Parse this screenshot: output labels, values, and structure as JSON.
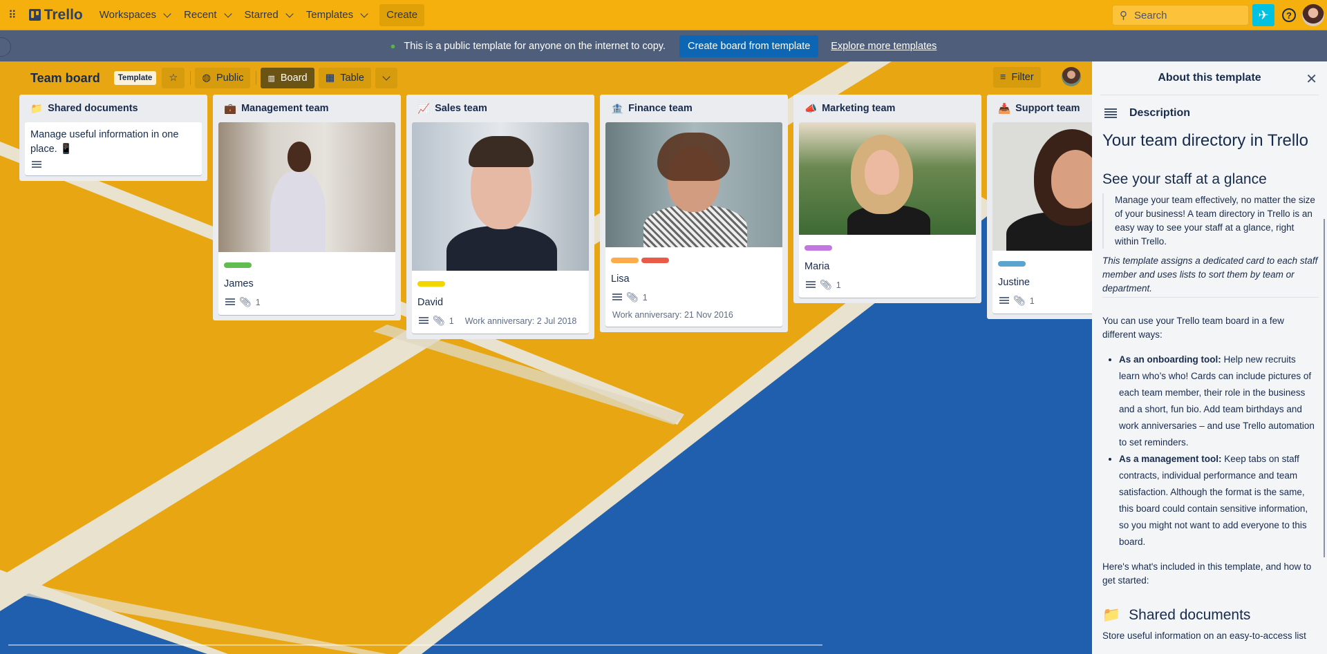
{
  "topbar": {
    "logo": "Trello",
    "nav": [
      "Workspaces",
      "Recent",
      "Starred",
      "Templates"
    ],
    "create": "Create",
    "search_placeholder": "Search",
    "help": "?"
  },
  "banner": {
    "text": "This is a public template for anyone on the internet to copy.",
    "button": "Create board from template",
    "link": "Explore more templates"
  },
  "board": {
    "title": "Team board",
    "badge": "Template",
    "visibility": "Public",
    "views": [
      "Board",
      "Table"
    ],
    "filter": "Filter"
  },
  "lists": [
    {
      "title": "Shared documents",
      "icon": "📁",
      "cards": [
        {
          "text": "Manage useful information in one place. 📱"
        }
      ]
    },
    {
      "title": "Management team",
      "icon": "💼",
      "cards": [
        {
          "name": "James",
          "labels": [
            "#61bd4f"
          ],
          "attachments": "1"
        }
      ]
    },
    {
      "title": "Sales team",
      "icon": "📈",
      "cards": [
        {
          "name": "David",
          "labels": [
            "#f2d600"
          ],
          "attachments": "1",
          "note": "Work anniversary: 2 Jul 2018"
        }
      ]
    },
    {
      "title": "Finance team",
      "icon": "🏦",
      "cards": [
        {
          "name": "Lisa",
          "labels": [
            "#ffab4a",
            "#eb5a46"
          ],
          "attachments": "1",
          "note": "Work anniversary: 21 Nov 2016"
        }
      ]
    },
    {
      "title": "Marketing team",
      "icon": "📣",
      "cards": [
        {
          "name": "Maria",
          "labels": [
            "#c377e0"
          ],
          "attachments": "1"
        }
      ]
    },
    {
      "title": "Support team",
      "icon": "📥",
      "cards": [
        {
          "name": "Justine",
          "labels": [
            "#5ba4cf"
          ],
          "attachments": "1"
        }
      ]
    }
  ],
  "panel": {
    "title": "About this template",
    "section": "Description",
    "h1": "Your team directory in Trello",
    "h2": "See your staff at a glance",
    "quote": "Manage your team effectively, no matter the size of your business! A team directory in Trello is an easy way to see your staff at a glance, right within Trello.",
    "italic": "This template assigns a dedicated card to each staff member and uses lists to sort them by team or department.",
    "intro": "You can use your Trello team board in a few different ways:",
    "bullets": [
      {
        "bold": "As an onboarding tool:",
        "text": " Help new recruits learn who’s who! Cards can include pictures of each team member, their role in the business and a short, fun bio. Add team birthdays and work anniversaries – and use Trello automation to set reminders."
      },
      {
        "bold": "As a management tool:",
        "text": " Keep tabs on staff contracts, individual performance and team satisfaction. Although the format is the same, this board could contain sensitive information, so you might not want to add everyone to this board."
      }
    ],
    "outro": "Here's what's included in this template, and how to get started:",
    "h2b": "Shared documents",
    "h2b_icon": "📁",
    "cut": "Store useful information on an easy-to-access list"
  },
  "colors": {
    "topbar": "#f5b00d",
    "banner": "#4f5e7b",
    "accent": "#0c66b4",
    "court_yellow": "#e9a813",
    "court_blue": "#1d5fb0"
  }
}
